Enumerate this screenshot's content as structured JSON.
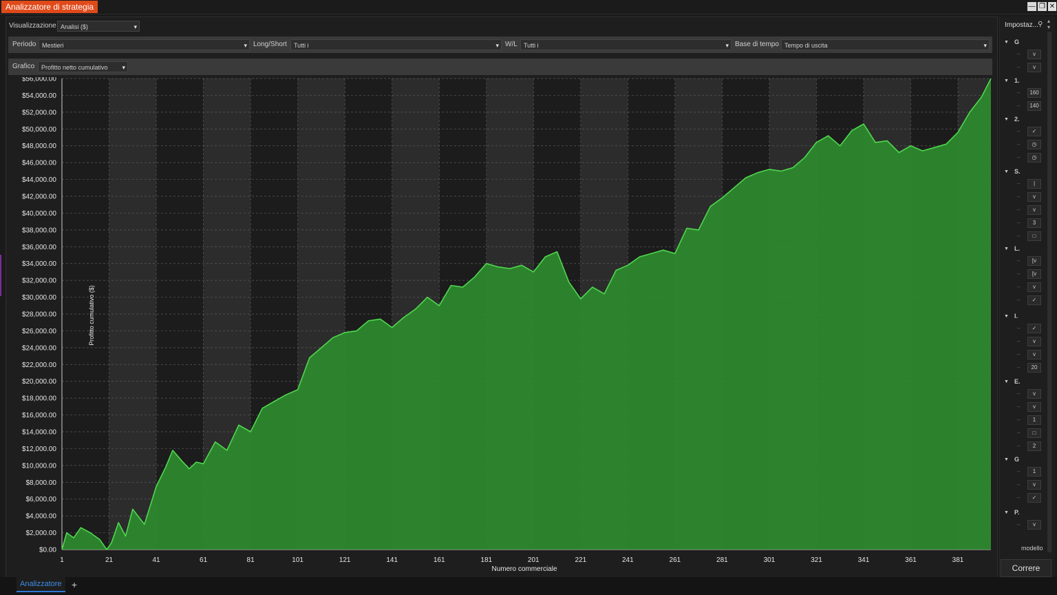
{
  "window": {
    "title": "Analizzatore di strategia",
    "buttons": {
      "minimize": "—",
      "restore": "❐",
      "close": "✕"
    }
  },
  "display": {
    "label": "Visualizzazione",
    "value": "Analisi ($)"
  },
  "filters": {
    "period": {
      "label": "Periodo",
      "value": "Mestieri"
    },
    "long_short": {
      "label": "Long/Short",
      "value": "Tutti i"
    },
    "win_loss": {
      "label": "W/L",
      "value": "Tutti i"
    },
    "time_base": {
      "label": "Base di tempo",
      "value": "Tempo di uscita"
    }
  },
  "chart_select": {
    "label": "Grafico",
    "value": "Profitto netto cumulativo"
  },
  "chart_data": {
    "type": "area",
    "title": "",
    "xlabel": "Numero commerciale",
    "ylabel": "Profitto cumulativo ($)",
    "ylim": [
      0,
      56000
    ],
    "xlim": [
      1,
      395
    ],
    "y_ticks": [
      "$0.00",
      "$2,000.00",
      "$4,000.00",
      "$6,000.00",
      "$8,000.00",
      "$10,000.00",
      "$12,000.00",
      "$14,000.00",
      "$16,000.00",
      "$18,000.00",
      "$20,000.00",
      "$22,000.00",
      "$24,000.00",
      "$26,000.00",
      "$28,000.00",
      "$30,000.00",
      "$32,000.00",
      "$34,000.00",
      "$36,000.00",
      "$38,000.00",
      "$40,000.00",
      "$42,000.00",
      "$44,000.00",
      "$46,000.00",
      "$48,000.00",
      "$50,000.00",
      "$52,000.00",
      "$54,000.00",
      "$56,000.00"
    ],
    "x_ticks": [
      "1",
      "21",
      "41",
      "61",
      "81",
      "101",
      "121",
      "141",
      "161",
      "181",
      "201",
      "221",
      "241",
      "261",
      "281",
      "301",
      "321",
      "341",
      "361",
      "381"
    ],
    "grid": true,
    "colors": {
      "fill": "#2e8b2e",
      "line": "#4fd84f",
      "band_dark": "#1c1c1c",
      "band_light": "#2c2c2c"
    },
    "series": [
      {
        "x": [
          1,
          3,
          6,
          9,
          13,
          17,
          20,
          22,
          25,
          28,
          31,
          36,
          41,
          45,
          48,
          52,
          55,
          58,
          61,
          66,
          71,
          76,
          81,
          86,
          91,
          96,
          101,
          106,
          111,
          116,
          121,
          126,
          131,
          136,
          141,
          146,
          151,
          156,
          161,
          166,
          171,
          176,
          181,
          186,
          191,
          196,
          201,
          206,
          211,
          216,
          221,
          226,
          231,
          236,
          241,
          246,
          251,
          256,
          261,
          266,
          271,
          276,
          281,
          286,
          291,
          296,
          301,
          306,
          311,
          316,
          321,
          326,
          331,
          336,
          341,
          346,
          351,
          356,
          361,
          366,
          371,
          376,
          381,
          386,
          391,
          395
        ],
        "y": [
          0,
          2000,
          1400,
          2600,
          2000,
          1200,
          0,
          800,
          3200,
          1600,
          4800,
          3000,
          7500,
          9800,
          11800,
          10500,
          9600,
          10400,
          10200,
          12800,
          11800,
          14800,
          14000,
          16800,
          17600,
          18400,
          19000,
          22800,
          24000,
          25200,
          25800,
          26000,
          27200,
          27400,
          26400,
          27600,
          28600,
          30000,
          29000,
          31400,
          31200,
          32400,
          34000,
          33600,
          33400,
          33800,
          33000,
          34800,
          35400,
          31800,
          29800,
          31200,
          30400,
          33200,
          33800,
          34800,
          35200,
          35600,
          35200,
          38200,
          38000,
          40800,
          41800,
          43000,
          44200,
          44800,
          45200,
          45000,
          45400,
          46600,
          48400,
          49200,
          48000,
          49800,
          50600,
          48400,
          48600,
          47200,
          48000,
          47400,
          47800,
          48200,
          49600,
          52000,
          53800,
          56000
        ]
      }
    ]
  },
  "side_panel": {
    "header": "Impostaz...",
    "pin_icon": "pin-icon",
    "groups": [
      {
        "label": "G",
        "controls": [
          "v",
          "v"
        ]
      },
      {
        "label": "1.",
        "controls": [
          "160",
          "140"
        ]
      },
      {
        "label": "2.",
        "controls": [
          "✓",
          "◷",
          "◷"
        ]
      },
      {
        "label": "S.",
        "controls": [
          "|",
          "v",
          "v",
          "3",
          "□"
        ]
      },
      {
        "label": "L.",
        "controls": [
          "[v",
          "[v",
          "v",
          "✓"
        ]
      },
      {
        "label": "I.",
        "controls": [
          "✓",
          "v",
          "v",
          "20"
        ]
      },
      {
        "label": "E.",
        "controls": [
          "v",
          "v",
          "1",
          "□",
          "2"
        ]
      },
      {
        "label": "G",
        "controls": [
          "1",
          "v",
          "✓"
        ]
      },
      {
        "label": "P.",
        "controls": [
          "v"
        ]
      }
    ],
    "footer_label": "modello",
    "run_label": "Correre"
  },
  "tabs": [
    {
      "label": "Analizzatore",
      "active": true
    }
  ],
  "add_tab": "+"
}
